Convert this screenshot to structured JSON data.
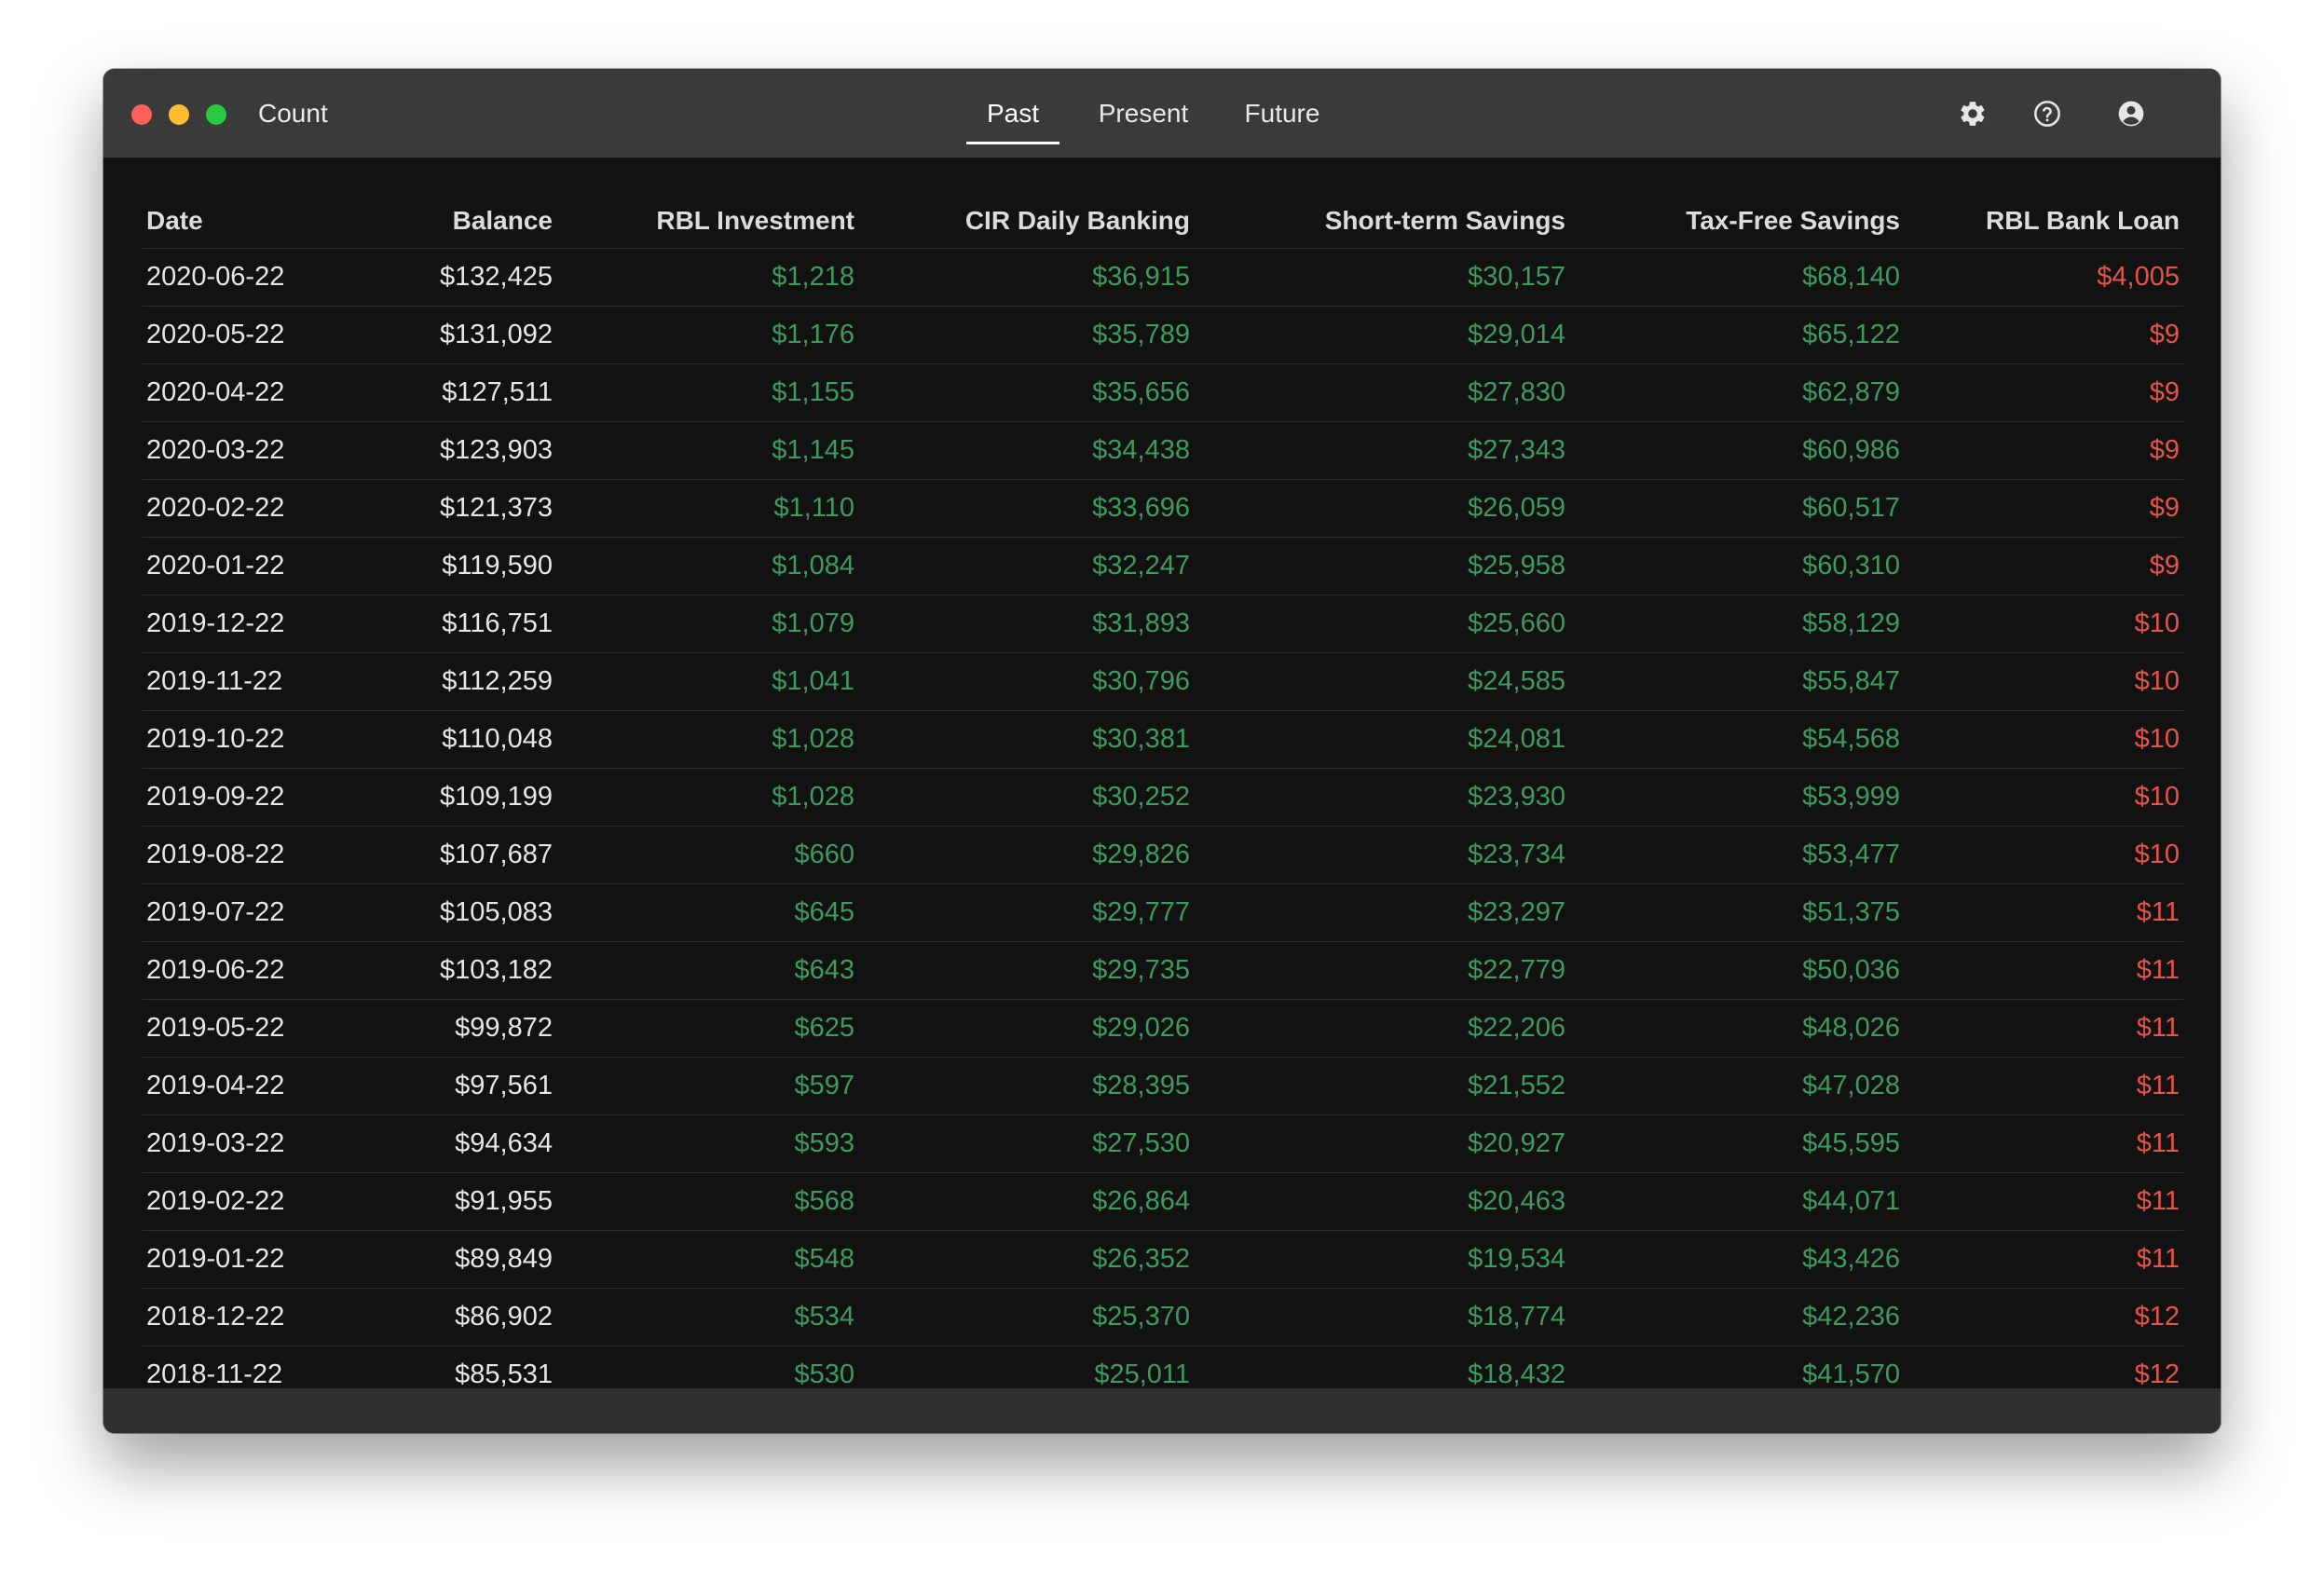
{
  "window": {
    "title": "Count"
  },
  "tabs": {
    "past": "Past",
    "present": "Present",
    "future": "Future",
    "active": "Past"
  },
  "toolbar": {
    "icons": [
      "gear-icon",
      "help-circle-icon",
      "user-circle-icon"
    ]
  },
  "colors": {
    "positive": "#3f9a5f",
    "negative": "#e5534b",
    "background": "#121212",
    "titlebar": "#3a3a3a"
  },
  "table": {
    "columns": [
      "Date",
      "Balance",
      "RBL Investment",
      "CIR Daily Banking",
      "Short-term Savings",
      "Tax-Free Savings",
      "RBL Bank Loan"
    ],
    "rows": [
      [
        "2020-06-22",
        "$132,425",
        "$1,218",
        "$36,915",
        "$30,157",
        "$68,140",
        "$4,005"
      ],
      [
        "2020-05-22",
        "$131,092",
        "$1,176",
        "$35,789",
        "$29,014",
        "$65,122",
        "$9"
      ],
      [
        "2020-04-22",
        "$127,511",
        "$1,155",
        "$35,656",
        "$27,830",
        "$62,879",
        "$9"
      ],
      [
        "2020-03-22",
        "$123,903",
        "$1,145",
        "$34,438",
        "$27,343",
        "$60,986",
        "$9"
      ],
      [
        "2020-02-22",
        "$121,373",
        "$1,110",
        "$33,696",
        "$26,059",
        "$60,517",
        "$9"
      ],
      [
        "2020-01-22",
        "$119,590",
        "$1,084",
        "$32,247",
        "$25,958",
        "$60,310",
        "$9"
      ],
      [
        "2019-12-22",
        "$116,751",
        "$1,079",
        "$31,893",
        "$25,660",
        "$58,129",
        "$10"
      ],
      [
        "2019-11-22",
        "$112,259",
        "$1,041",
        "$30,796",
        "$24,585",
        "$55,847",
        "$10"
      ],
      [
        "2019-10-22",
        "$110,048",
        "$1,028",
        "$30,381",
        "$24,081",
        "$54,568",
        "$10"
      ],
      [
        "2019-09-22",
        "$109,199",
        "$1,028",
        "$30,252",
        "$23,930",
        "$53,999",
        "$10"
      ],
      [
        "2019-08-22",
        "$107,687",
        "$660",
        "$29,826",
        "$23,734",
        "$53,477",
        "$10"
      ],
      [
        "2019-07-22",
        "$105,083",
        "$645",
        "$29,777",
        "$23,297",
        "$51,375",
        "$11"
      ],
      [
        "2019-06-22",
        "$103,182",
        "$643",
        "$29,735",
        "$22,779",
        "$50,036",
        "$11"
      ],
      [
        "2019-05-22",
        "$99,872",
        "$625",
        "$29,026",
        "$22,206",
        "$48,026",
        "$11"
      ],
      [
        "2019-04-22",
        "$97,561",
        "$597",
        "$28,395",
        "$21,552",
        "$47,028",
        "$11"
      ],
      [
        "2019-03-22",
        "$94,634",
        "$593",
        "$27,530",
        "$20,927",
        "$45,595",
        "$11"
      ],
      [
        "2019-02-22",
        "$91,955",
        "$568",
        "$26,864",
        "$20,463",
        "$44,071",
        "$11"
      ],
      [
        "2019-01-22",
        "$89,849",
        "$548",
        "$26,352",
        "$19,534",
        "$43,426",
        "$11"
      ],
      [
        "2018-12-22",
        "$86,902",
        "$534",
        "$25,370",
        "$18,774",
        "$42,236",
        "$12"
      ],
      [
        "2018-11-22",
        "$85,531",
        "$530",
        "$25,011",
        "$18,432",
        "$41,570",
        "$12"
      ]
    ]
  }
}
